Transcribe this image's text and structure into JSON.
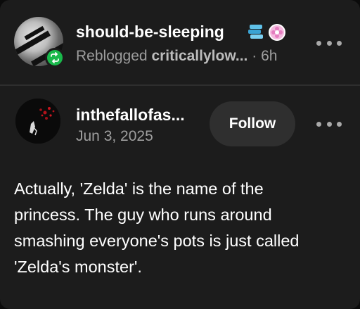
{
  "reblog": {
    "username": "should-be-sleeping",
    "label": "Reblogged",
    "source": "criticallylow...",
    "separator": "·",
    "time": "6h"
  },
  "original_post": {
    "username": "inthefallofas...",
    "date": "Jun 3, 2025",
    "follow_label": "Follow",
    "body": [
      "Actually, 'Zelda' is the name of the",
      "princess. The guy who runs around",
      "smashing everyone's pots is just called",
      "'Zelda's monster'."
    ]
  },
  "colors": {
    "background": "#1c1c1c",
    "reblog_badge": "#19b94b",
    "muted_text": "#9e9e9e",
    "follow_button": "#2f2f2f"
  },
  "icons": {
    "reblog_badge": "reblog-icon",
    "menu": "more-options-icon",
    "user_badges": [
      "stacked-badge-icon",
      "flower-badge-icon"
    ]
  }
}
